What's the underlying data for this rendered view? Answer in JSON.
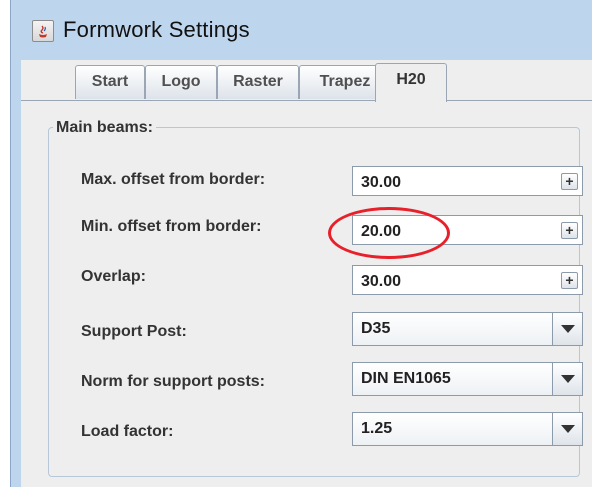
{
  "window": {
    "title": "Formwork Settings"
  },
  "tabs": [
    {
      "label": "Start"
    },
    {
      "label": "Logo"
    },
    {
      "label": "Raster"
    },
    {
      "label": "Trapez"
    },
    {
      "label": "H20"
    }
  ],
  "group": {
    "title": "Main beams:",
    "fields": {
      "max_offset": {
        "label": "Max. offset from border:",
        "value": "30.00"
      },
      "min_offset": {
        "label": "Min. offset from border:",
        "value": "20.00"
      },
      "overlap": {
        "label": "Overlap:",
        "value": "30.00"
      },
      "support_post": {
        "label": "Support Post:",
        "value": "D35"
      },
      "norm": {
        "label": "Norm for support posts:",
        "value": "DIN EN1065"
      },
      "load_factor": {
        "label": "Load factor:",
        "value": "1.25"
      }
    }
  },
  "colors": {
    "highlight": "#e8202a",
    "titlebar": "#bed5ee"
  }
}
